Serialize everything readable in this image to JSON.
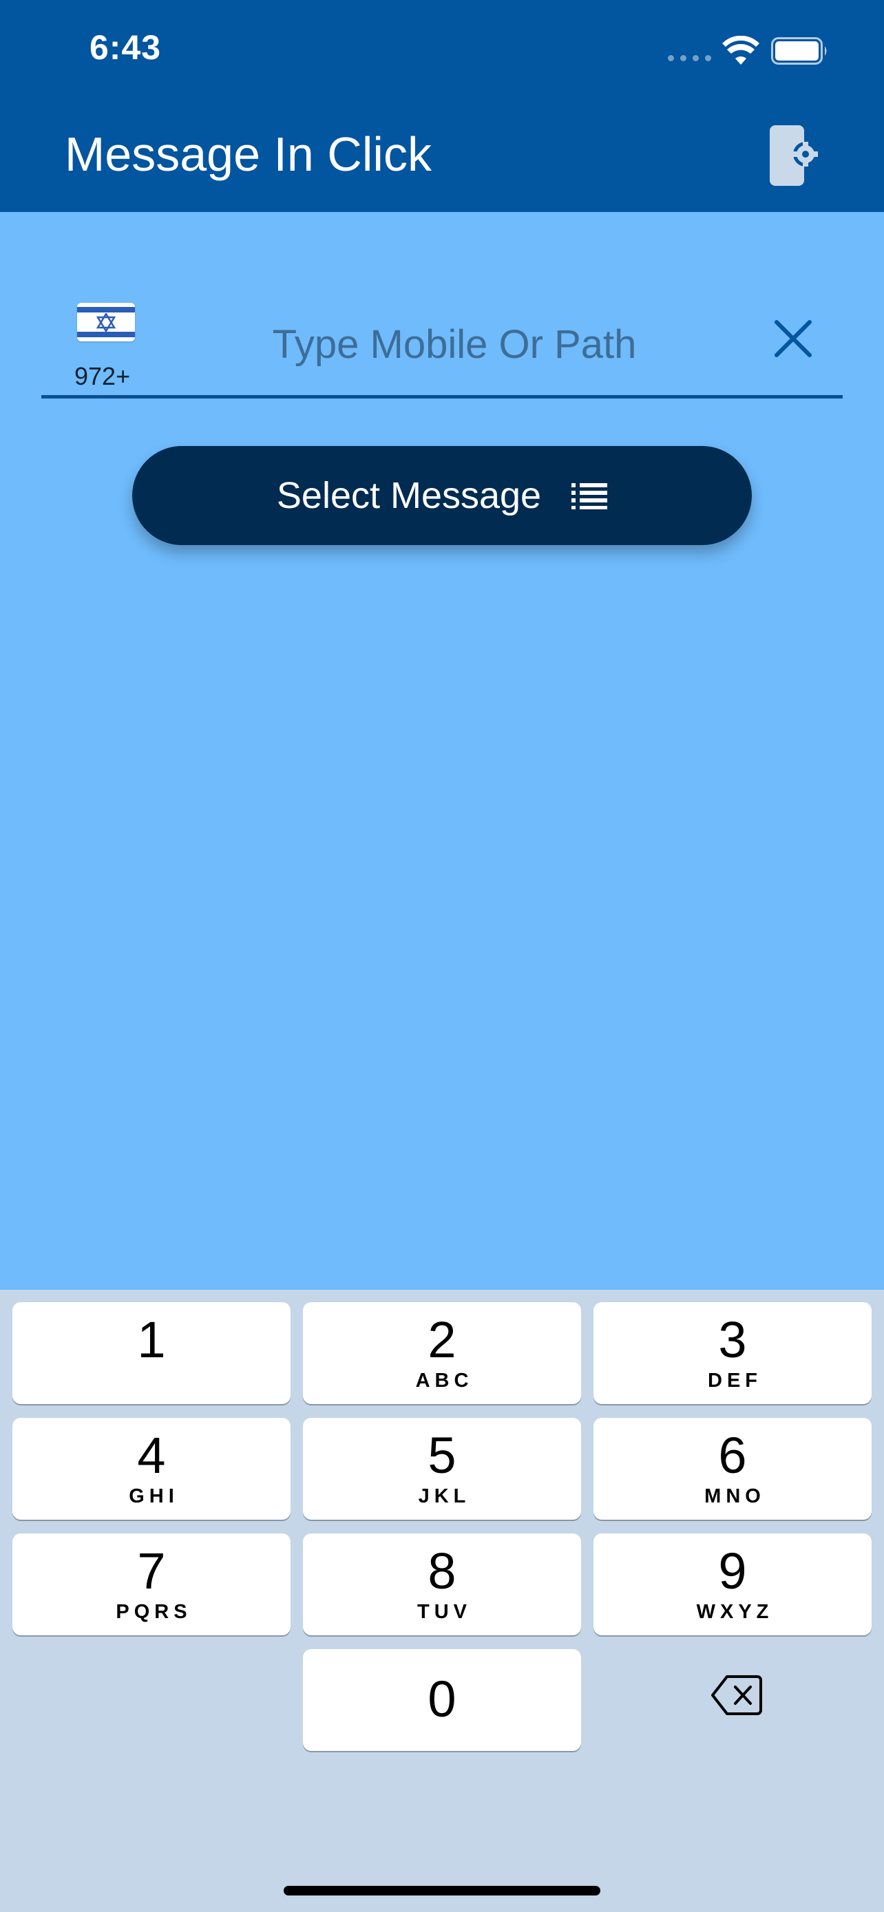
{
  "status_bar": {
    "time": "6:43"
  },
  "header": {
    "title": "Message In Click",
    "settings_icon": "mobile-settings-icon"
  },
  "phone": {
    "country_flag": "israel-flag-icon",
    "country_code": "972+",
    "placeholder": "Type Mobile Or Path",
    "value": "",
    "clear_icon": "close-icon"
  },
  "select_button": {
    "label": "Select Message",
    "icon": "list-icon"
  },
  "keypad": {
    "keys": [
      {
        "digit": "1",
        "letters": ""
      },
      {
        "digit": "2",
        "letters": "ABC"
      },
      {
        "digit": "3",
        "letters": "DEF"
      },
      {
        "digit": "4",
        "letters": "GHI"
      },
      {
        "digit": "5",
        "letters": "JKL"
      },
      {
        "digit": "6",
        "letters": "MNO"
      },
      {
        "digit": "7",
        "letters": "PQRS"
      },
      {
        "digit": "8",
        "letters": "TUV"
      },
      {
        "digit": "9",
        "letters": "WXYZ"
      },
      {
        "digit": "0",
        "letters": ""
      }
    ],
    "backspace_icon": "backspace-icon"
  },
  "colors": {
    "header": "#02559f",
    "background": "#6fbbfc",
    "button": "#022b52",
    "keypad": "#c4d6e7"
  }
}
